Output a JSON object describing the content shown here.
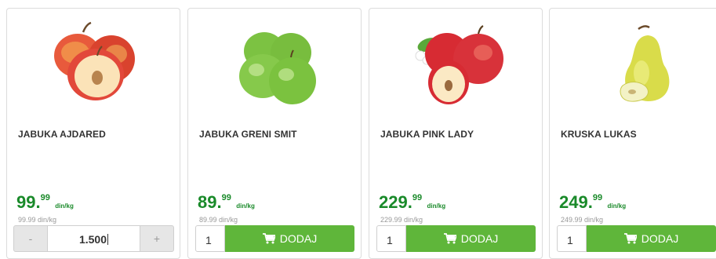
{
  "products": [
    {
      "name": "JABUKA AJDARED",
      "price_int": "99.",
      "price_cents": "99",
      "unit": "din/kg",
      "old_price": "99.99 din/kg",
      "qty": "1.500"
    },
    {
      "name": "JABUKA GRENI SMIT",
      "price_int": "89.",
      "price_cents": "99",
      "unit": "din/kg",
      "old_price": "89.99 din/kg",
      "qty": "1",
      "add_label": "DODAJ"
    },
    {
      "name": "JABUKA PINK LADY",
      "price_int": "229.",
      "price_cents": "99",
      "unit": "din/kg",
      "old_price": "229.99 din/kg",
      "qty": "1",
      "add_label": "DODAJ"
    },
    {
      "name": "KRUSKA LUKAS",
      "price_int": "249.",
      "price_cents": "99",
      "unit": "din/kg",
      "old_price": "249.99 din/kg",
      "qty": "1",
      "add_label": "DODAJ"
    }
  ],
  "stepper": {
    "minus": "-",
    "plus": "+"
  },
  "icons": {
    "cart": "cart-icon"
  },
  "colors": {
    "price": "#1a8a2a",
    "button": "#5fb63a"
  }
}
